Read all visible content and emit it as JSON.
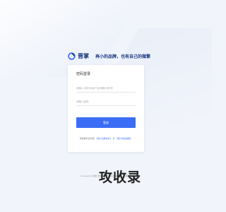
{
  "brand": {
    "logo_text": "晋掌",
    "slogan": "再小的品牌，也有自己的微擎",
    "accent": "#1a3a80"
  },
  "login": {
    "title": "密码登录",
    "account_placeholder": "请输入手机号/用户名/邮箱/手机号",
    "password_placeholder": "请输入密码",
    "button_label": "登录",
    "button_color": "#3b6cf5",
    "agreement_prefix": "登录即代表同意",
    "agreement_link1": "《用户注册协议》",
    "agreement_and": "及",
    "agreement_link2": "《用户隐私政策》"
  },
  "footer": {
    "text": "Powered by 微擎 (微信第三方平台) 版权所有 微擎 2.0"
  },
  "watermark": {
    "text": "攻收录"
  }
}
